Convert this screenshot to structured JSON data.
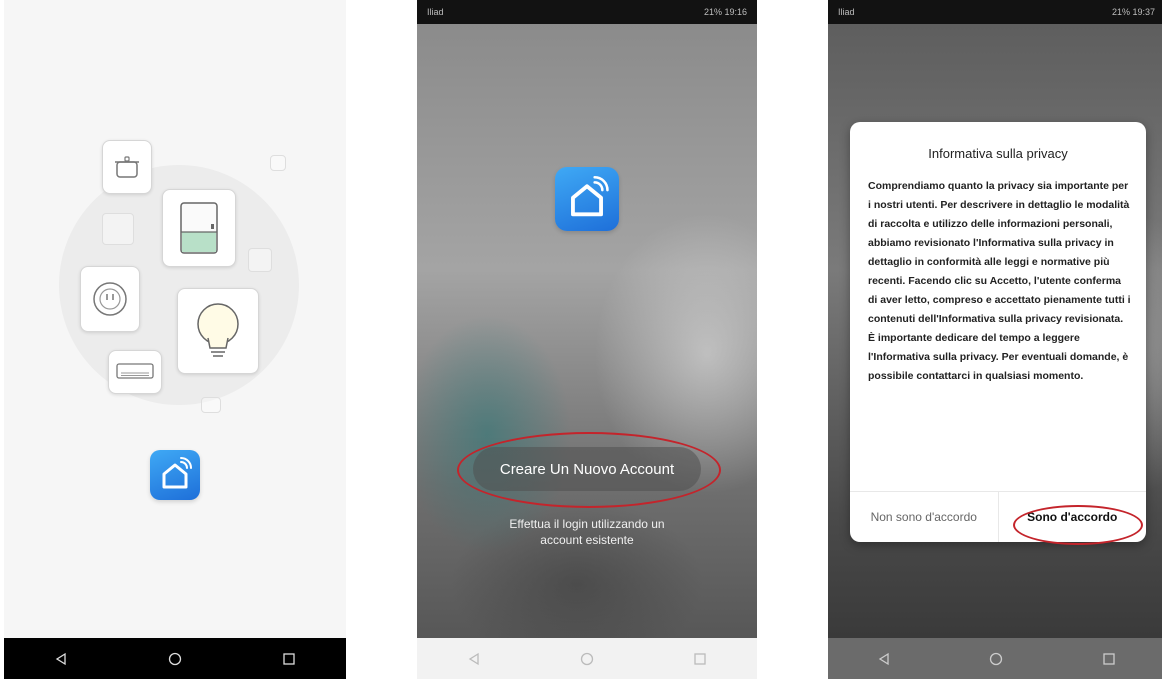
{
  "screens": {
    "splash": {
      "nav": {
        "back_icon": "triangle-back",
        "home_icon": "circle-home",
        "recents_icon": "square-recents"
      }
    },
    "welcome": {
      "status_left": "Iliad",
      "status_right": "21% 19:16",
      "create_account_label": "Creare Un Nuovo Account",
      "login_link_line1": "Effettua il login utilizzando un",
      "login_link_line2": "account esistente"
    },
    "privacy": {
      "status_left": "Iliad",
      "status_right": "21% 19:37",
      "dialog_title": "Informativa sulla privacy",
      "dialog_body": "Comprendiamo quanto la privacy sia importante per i nostri utenti. Per descrivere in dettaglio le modalità di raccolta e utilizzo delle informazioni personali, abbiamo revisionato l'Informativa sulla privacy in dettaglio in conformità alle leggi e normative più recenti. Facendo clic su Accetto, l'utente conferma di aver letto, compreso e accettato pienamente tutti i contenuti dell'Informativa sulla privacy revisionata. È importante dedicare del tempo a leggere l'Informativa sulla privacy. Per eventuali domande, è possibile contattarci in qualsiasi momento.",
      "disagree_label": "Non sono d'accordo",
      "agree_label": "Sono d'accordo"
    }
  },
  "colors": {
    "brand_gradient_start": "#3fa9f5",
    "brand_gradient_end": "#1e6fd9",
    "highlight_oval": "#c4242b"
  }
}
